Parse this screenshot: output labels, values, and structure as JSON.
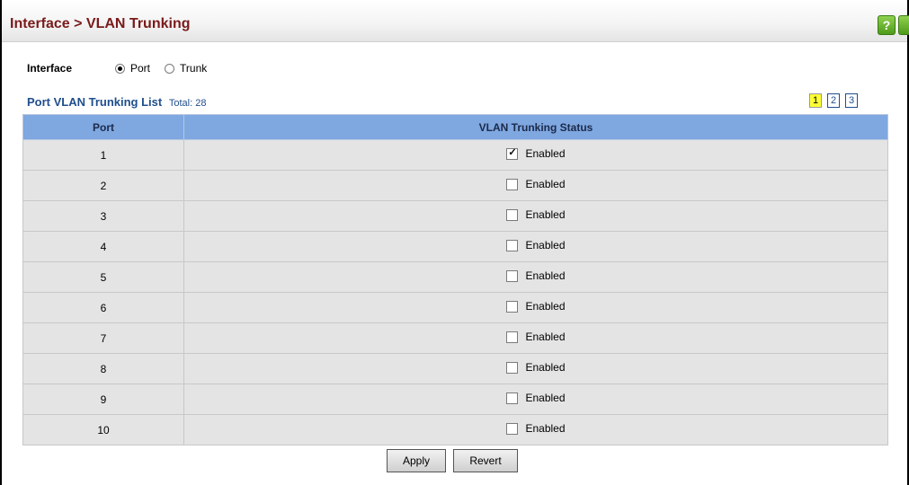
{
  "page": {
    "title": "Interface > VLAN Trunking"
  },
  "toolbar": {
    "help_icon": "help-icon",
    "help_label": "?"
  },
  "interface_selector": {
    "label": "Interface",
    "options": [
      "Port",
      "Trunk"
    ],
    "selected": "Port"
  },
  "list": {
    "title": "Port VLAN Trunking List",
    "total": "Total: 28",
    "pages": [
      "1",
      "2",
      "3"
    ],
    "current_page": "1",
    "columns": [
      "Port",
      "VLAN Trunking Status"
    ],
    "checkbox_label": "Enabled",
    "rows": [
      {
        "port": "1",
        "enabled": true
      },
      {
        "port": "2",
        "enabled": false
      },
      {
        "port": "3",
        "enabled": false
      },
      {
        "port": "4",
        "enabled": false
      },
      {
        "port": "5",
        "enabled": false
      },
      {
        "port": "6",
        "enabled": false
      },
      {
        "port": "7",
        "enabled": false
      },
      {
        "port": "8",
        "enabled": false
      },
      {
        "port": "9",
        "enabled": false
      },
      {
        "port": "10",
        "enabled": false
      }
    ]
  },
  "actions": {
    "apply_label": "Apply",
    "revert_label": "Revert"
  },
  "colors": {
    "title": "#7a1a1a",
    "list_title": "#1f4e8c",
    "table_header": "#7fa7e0",
    "row_bg": "#e4e4e4"
  }
}
